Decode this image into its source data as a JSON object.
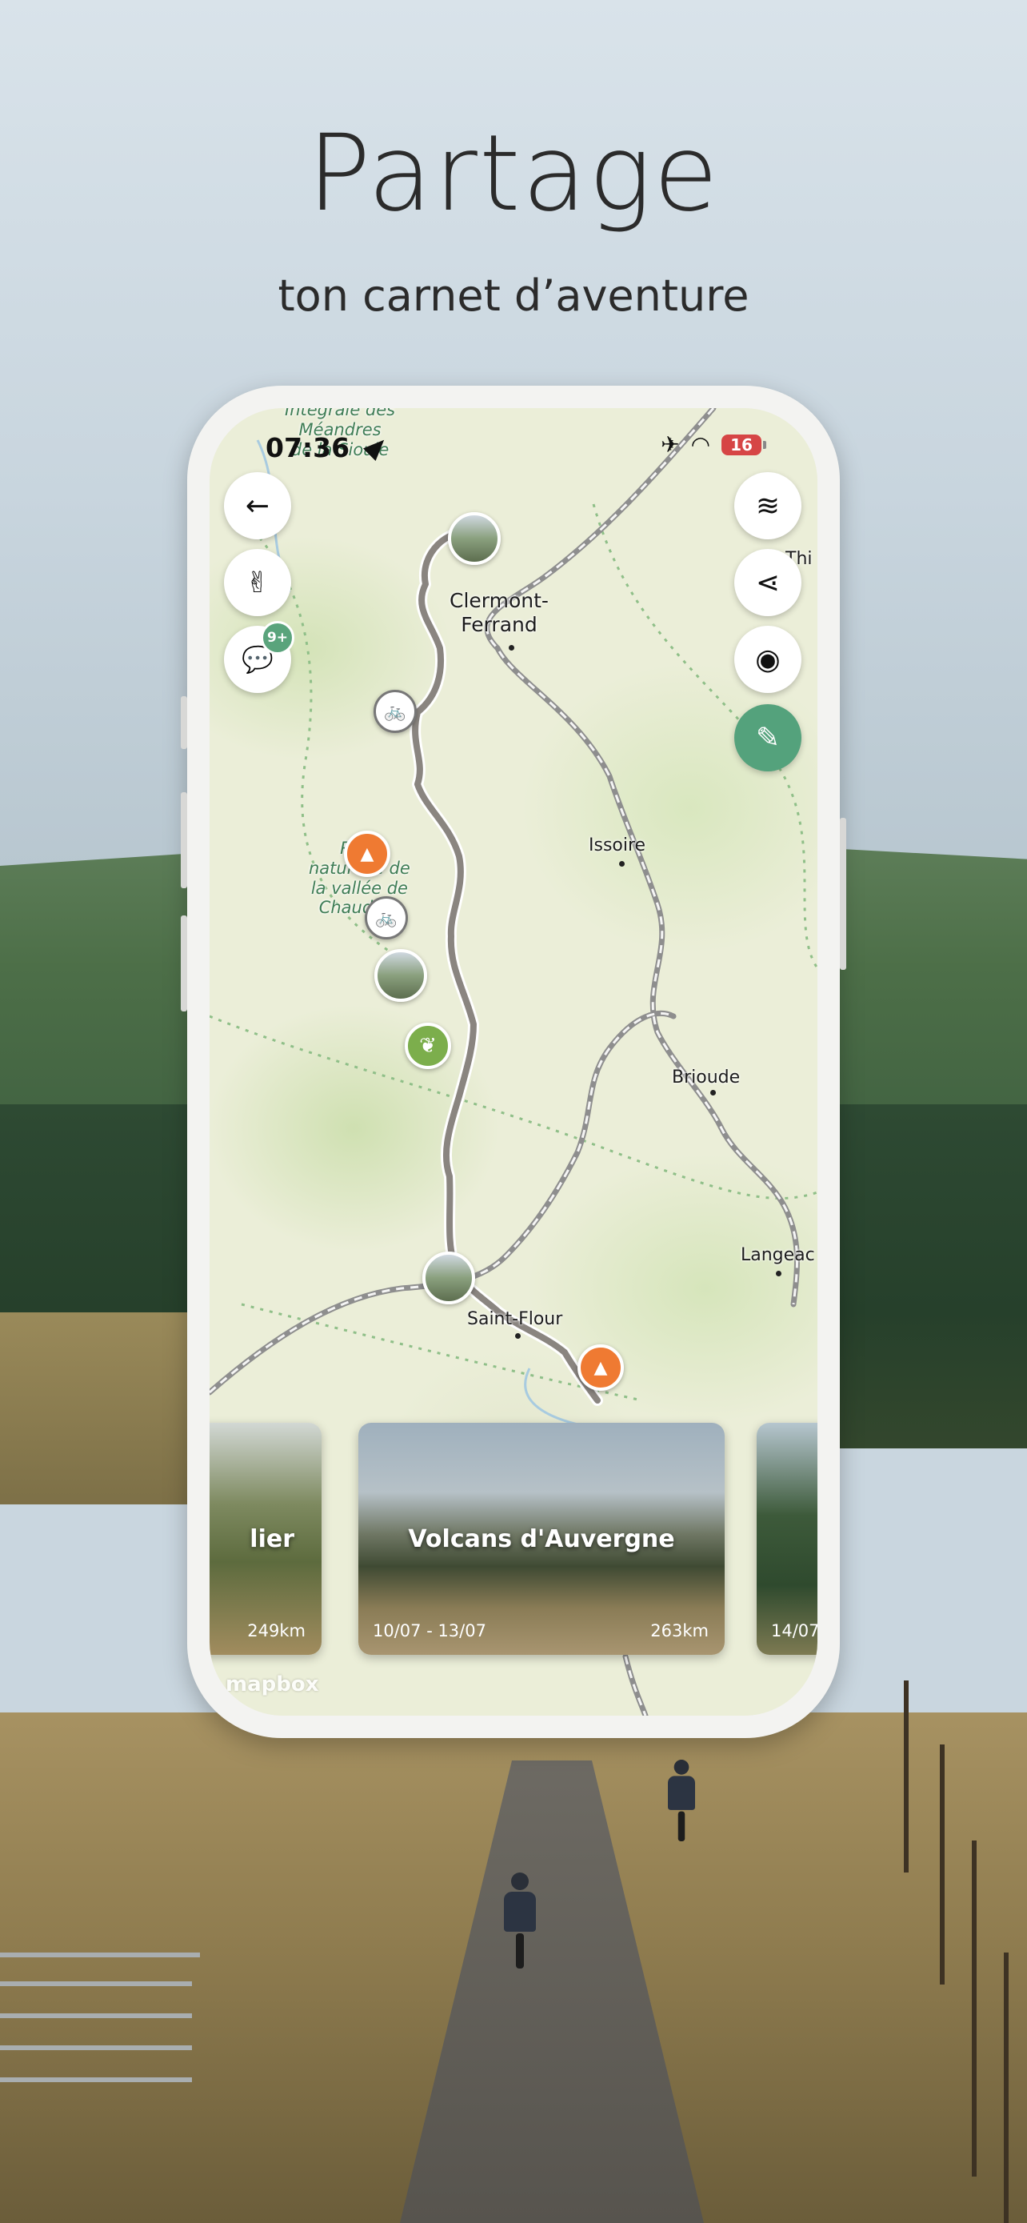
{
  "header": {
    "title": "Partage",
    "subtitle": "ton carnet d’aventure"
  },
  "status_bar": {
    "time": "07:36",
    "battery": "16",
    "airplane_icon": "airplane-icon",
    "wifi_icon": "wifi-icon"
  },
  "map_controls": {
    "left": [
      {
        "name": "back-button",
        "icon": "arrow-left-icon",
        "glyph": "←"
      },
      {
        "name": "peace-button",
        "icon": "peace-hand-icon",
        "glyph": "✌"
      },
      {
        "name": "comments-button",
        "icon": "chat-bubbles-icon",
        "glyph": "💬",
        "badge": "9+"
      }
    ],
    "right": [
      {
        "name": "layers-button",
        "icon": "layers-icon",
        "glyph": "≋"
      },
      {
        "name": "share-button",
        "icon": "share-icon",
        "glyph": "⋖"
      },
      {
        "name": "visibility-button",
        "icon": "eye-icon",
        "glyph": "◉"
      },
      {
        "name": "edit-button",
        "icon": "pencil-icon",
        "glyph": "✎"
      }
    ]
  },
  "map": {
    "labels": {
      "meandres": "Intégrale des\nMéandres\nde la Sioule",
      "clermont": "Clermont-\nFerrand",
      "issoire": "Issoire",
      "reserve": "Ré…\nnaturelle de\nla vallée de\nChaude…",
      "brioude": "Brioude",
      "langeac": "Langeac",
      "saint_flour": "Saint-Flour",
      "thiers": "Thi"
    },
    "attribution": "mapbox"
  },
  "trips": [
    {
      "title": "lier",
      "date": "",
      "distance": "249km"
    },
    {
      "title": "Volcans d'Auvergne",
      "date": "10/07 - 13/07",
      "distance": "263km"
    },
    {
      "title": "",
      "date": "14/07",
      "distance": ""
    }
  ],
  "colors": {
    "accent_green": "#54a27c",
    "camp_orange": "#ef7a32",
    "nature_green": "#7cae4c",
    "route_gray": "#8a8580"
  }
}
